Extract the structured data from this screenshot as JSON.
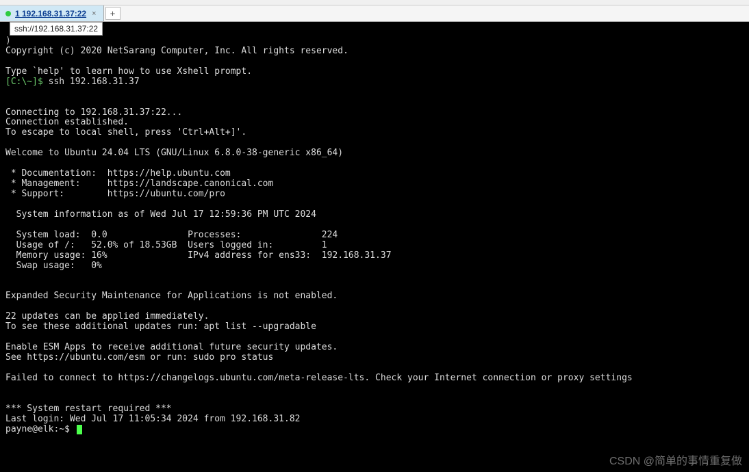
{
  "tab": {
    "title": "1 192.168.31.37:22",
    "close": "×",
    "add": "+",
    "tooltip": "ssh://192.168.31.37:22"
  },
  "terminal": {
    "partial_right": ")",
    "copyright": "Copyright (c) 2020 NetSarang Computer, Inc. All rights reserved.",
    "blank1": "",
    "help_line": "Type `help' to learn how to use Xshell prompt.",
    "prompt_local": "[C:\\~]$",
    "ssh_command": " ssh 192.168.31.37",
    "blank2": "",
    "blank3": "",
    "connecting": "Connecting to 192.168.31.37:22...",
    "established": "Connection established.",
    "escape": "To escape to local shell, press 'Ctrl+Alt+]'.",
    "blank4": "",
    "welcome": "Welcome to Ubuntu 24.04 LTS (GNU/Linux 6.8.0-38-generic x86_64)",
    "blank5": "",
    "doc": " * Documentation:  https://help.ubuntu.com",
    "mgmt": " * Management:     https://landscape.canonical.com",
    "support": " * Support:        https://ubuntu.com/pro",
    "blank6": "",
    "sysinfo": "  System information as of Wed Jul 17 12:59:36 PM UTC 2024",
    "blank7": "",
    "row1": "  System load:  0.0               Processes:               224",
    "row2": "  Usage of /:   52.0% of 18.53GB  Users logged in:         1",
    "row3": "  Memory usage: 16%               IPv4 address for ens33:  192.168.31.37",
    "row4": "  Swap usage:   0%",
    "blank8": "",
    "blank9": "",
    "esm1": "Expanded Security Maintenance for Applications is not enabled.",
    "blank10": "",
    "updates1": "22 updates can be applied immediately.",
    "updates2": "To see these additional updates run: apt list --upgradable",
    "blank11": "",
    "esm2": "Enable ESM Apps to receive additional future security updates.",
    "esm3": "See https://ubuntu.com/esm or run: sudo pro status",
    "blank12": "",
    "fail": "Failed to connect to https://changelogs.ubuntu.com/meta-release-lts. Check your Internet connection or proxy settings",
    "blank13": "",
    "blank14": "",
    "restart": "*** System restart required ***",
    "lastlogin": "Last login: Wed Jul 17 11:05:34 2024 from 192.168.31.82",
    "shell_prompt": "payne@elk:~$ "
  },
  "watermark": "CSDN @简单的事情重复做"
}
